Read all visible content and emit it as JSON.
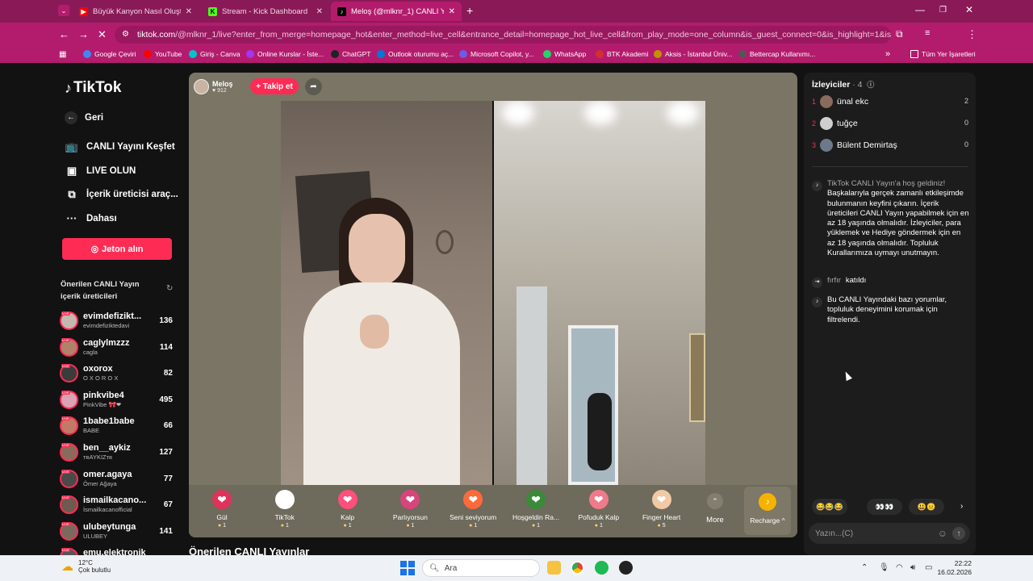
{
  "browser": {
    "tabs": [
      {
        "title": "Büyük Kanyon Nasıl Oluştu? - Y",
        "icon": "youtube-icon",
        "color": "#ff0000"
      },
      {
        "title": "Stream - Kick Dashboard",
        "icon": "kick-icon",
        "color": "#53fc18"
      },
      {
        "title": "Meloş (@mlknr_1) CANLI Yayını",
        "icon": "tiktok-icon",
        "color": "#000000"
      }
    ],
    "new_tab_label": "+",
    "window_controls": [
      "—",
      "❐",
      "✕"
    ],
    "url_host": "tiktok.com",
    "url_rest": "/@mlknr_1/live?enter_from_merge=homepage_hot&enter_method=live_cell&entrance_detail=homepage_hot_live_cell&from_play_mode=one_column&is_guest_connect=0&is_highlight=1&is_lands...",
    "bookmarks": [
      {
        "label": "Google Çeviri",
        "color": "#4285f4"
      },
      {
        "label": "YouTube",
        "color": "#ff0000"
      },
      {
        "label": "Giriş - Canva",
        "color": "#00c4cc"
      },
      {
        "label": "Online Kurslar - İste...",
        "color": "#a435f0"
      },
      {
        "label": "ChatGPT",
        "color": "#222222"
      },
      {
        "label": "Outlook oturumu aç...",
        "color": "#0078d4"
      },
      {
        "label": "Microsoft Copilot, y...",
        "color": "#6c5ce7"
      },
      {
        "label": "WhatsApp",
        "color": "#25d366"
      },
      {
        "label": "BTK Akademi",
        "color": "#d32f2f"
      },
      {
        "label": "Aksis - İstanbul Üniv...",
        "color": "#c49000"
      },
      {
        "label": "Bettercap Kullanımı...",
        "color": "#555555"
      }
    ],
    "bookmarks_more": "»",
    "all_bookmarks": "Tüm Yer İşaretleri",
    "accent": "#b31c6d"
  },
  "sidebar": {
    "logo": "TikTok",
    "back": "Geri",
    "nav": [
      {
        "label": "CANLI Yayını Keşfet",
        "icon": "tv-icon"
      },
      {
        "label": "LIVE OLUN",
        "icon": "camera-icon"
      },
      {
        "label": "İçerik üreticisi araç...",
        "icon": "creator-tools-icon"
      },
      {
        "label": "Dahası",
        "icon": "more-icon"
      }
    ],
    "coin_button": "Jeton alın",
    "suggested_heading": "Önerilen CANLI Yayın içerik üreticileri",
    "creators": [
      {
        "name": "evimdefizikt...",
        "sub": "evimdefiziktedavi",
        "count": "136",
        "color": "#c4b8b0"
      },
      {
        "name": "caglylmzzz",
        "sub": "cagla",
        "count": "114",
        "color": "#b0826a"
      },
      {
        "name": "oxorox",
        "sub": "O X O R O X",
        "count": "82",
        "color": "#3b3b3b"
      },
      {
        "name": "pinkvibe4",
        "sub": "PinkVibe 🎀❤",
        "count": "495",
        "color": "#d9a3b5"
      },
      {
        "name": "1babe1babe",
        "sub": "BABE",
        "count": "66",
        "color": "#c27a66"
      },
      {
        "name": "ben__aykiz",
        "sub": "ᴛʀAYKIZᴛʀ",
        "count": "127",
        "color": "#8a6b5a"
      },
      {
        "name": "omer.agaya",
        "sub": "Ömer Ağaya",
        "count": "77",
        "color": "#4a4a4a"
      },
      {
        "name": "ismailkacano...",
        "sub": "İsmailkacanofficial",
        "count": "67",
        "color": "#6e5a4e"
      },
      {
        "name": "ulubeytunga",
        "sub": "ULUBEY",
        "count": "141",
        "color": "#7a6a5e"
      },
      {
        "name": "emu.elektronik",
        "sub": "",
        "count": "",
        "color": "#555555"
      }
    ]
  },
  "stream": {
    "host_name": "Meloş",
    "host_likes": "912",
    "follow_label": "+ Takip et",
    "gifts": [
      {
        "label": "Gül",
        "price": "1",
        "icon": "rose-icon",
        "color": "#e0335a"
      },
      {
        "label": "TikTok",
        "price": "1",
        "icon": "tiktok-gift-icon",
        "color": "#ffffff"
      },
      {
        "label": "Kalp",
        "price": "1",
        "icon": "heart-icon",
        "color": "#ff4f7b"
      },
      {
        "label": "Parlıyorsun",
        "price": "1",
        "icon": "sparkle-icon",
        "color": "#d8457a"
      },
      {
        "label": "Seni seviyorum",
        "price": "1",
        "icon": "love-icon",
        "color": "#ff6a3a"
      },
      {
        "label": "Hoşgeldin Ra...",
        "price": "1",
        "icon": "ramadan-icon",
        "color": "#3a8a3a"
      },
      {
        "label": "Pofuduk Kalp",
        "price": "1",
        "icon": "fluffy-heart-icon",
        "color": "#f07a8a"
      },
      {
        "label": "Finger Heart",
        "price": "5",
        "icon": "finger-heart-icon",
        "color": "#f2c9a5"
      }
    ],
    "more_label": "More",
    "recharge_label": "Recharge ^",
    "suggested_title": "Önerilen CANLI Yayınlar"
  },
  "chat": {
    "viewers_label": "İzleyiciler",
    "viewers_count": "· 4",
    "viewers": [
      {
        "rank": "1",
        "name": "ünal ekc",
        "score": "2",
        "color": "#8a6a5a"
      },
      {
        "rank": "2",
        "name": "tuğçe",
        "score": "0",
        "color": "#cfcfcf"
      },
      {
        "rank": "3",
        "name": "Bülent Demirtaş",
        "score": "0",
        "color": "#6b7a8a"
      }
    ],
    "welcome_head": "TikTok CANLI Yayın'a hoş geldiniz!",
    "welcome_body": "Başkalarıyla gerçek zamanlı etkileşimde bulunmanın keyfini çıkarın. İçerik üreticileri CANLI Yayın yapabilmek için en az 18 yaşında olmalıdır. İzleyiciler, para yüklemek ve Hediye göndermek için en az 18 yaşında olmalıdır. Topluluk Kurallarımıza uymayı unutmayın.",
    "join_user": "fırfır",
    "join_text": "katıldı",
    "filter_note": "Bu CANLI Yayındaki bazı yorumlar, topluluk deneyimini korumak için filtrelendi.",
    "emoji_groups": [
      "😂😂😂",
      "👀👀",
      "😃😐"
    ],
    "input_placeholder": "Yazın...(C)"
  },
  "taskbar": {
    "temp": "12°C",
    "weather": "Çok bulutlu",
    "search": "Ara",
    "time": "22:22",
    "date": "16.02.2026"
  }
}
